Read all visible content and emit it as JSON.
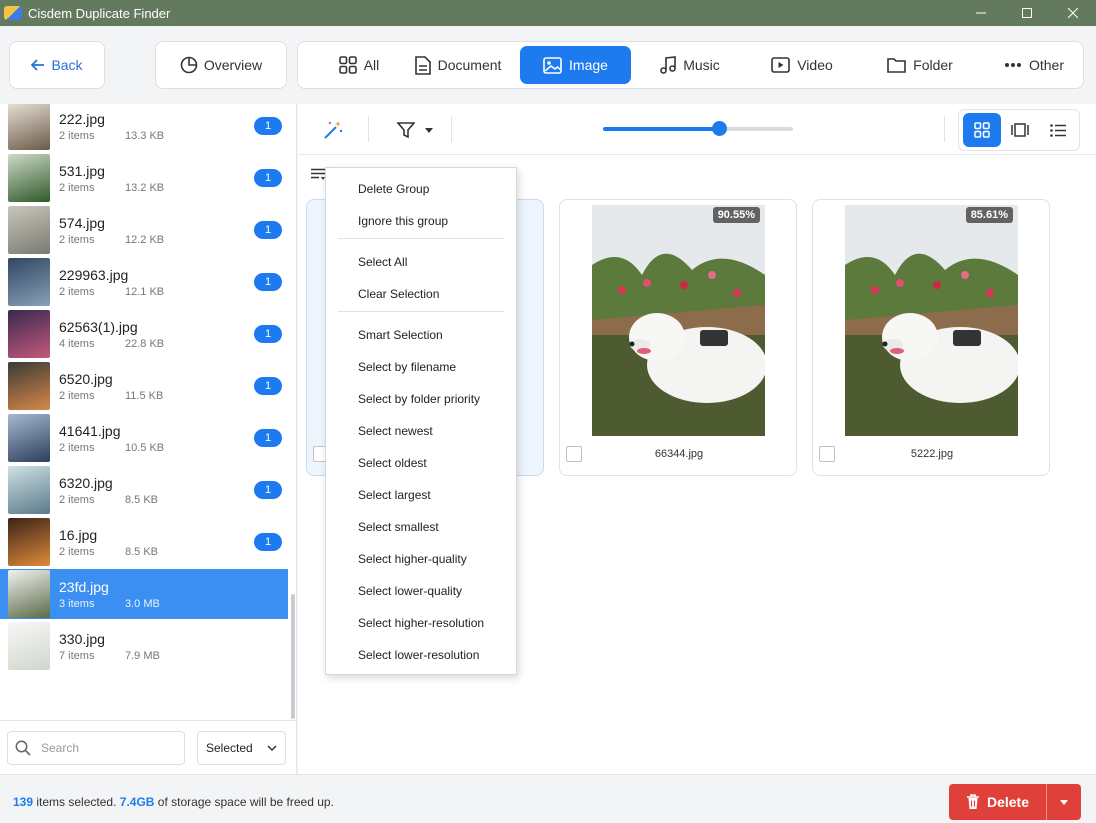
{
  "window": {
    "title": "Cisdem Duplicate Finder"
  },
  "nav": {
    "back_label": "Back",
    "overview_label": "Overview",
    "tabs": [
      {
        "label": "All",
        "icon": "grid-icon"
      },
      {
        "label": "Document",
        "icon": "document-icon"
      },
      {
        "label": "Image",
        "icon": "image-icon",
        "active": true
      },
      {
        "label": "Music",
        "icon": "music-note-icon"
      },
      {
        "label": "Video",
        "icon": "video-icon"
      },
      {
        "label": "Folder",
        "icon": "folder-icon"
      },
      {
        "label": "Other",
        "icon": "more-dots-icon"
      }
    ]
  },
  "sidebar": {
    "groups": [
      {
        "name": "222.jpg",
        "count": "2 items",
        "size": "13.3 KB",
        "badge": "1"
      },
      {
        "name": "531.jpg",
        "count": "2 items",
        "size": "13.2 KB",
        "badge": "1"
      },
      {
        "name": "574.jpg",
        "count": "2 items",
        "size": "12.2 KB",
        "badge": "1"
      },
      {
        "name": "229963.jpg",
        "count": "2 items",
        "size": "12.1 KB",
        "badge": "1"
      },
      {
        "name": "62563(1).jpg",
        "count": "4 items",
        "size": "22.8 KB",
        "badge": "1"
      },
      {
        "name": "6520.jpg",
        "count": "2 items",
        "size": "11.5 KB",
        "badge": "1"
      },
      {
        "name": "41641.jpg",
        "count": "2 items",
        "size": "10.5 KB",
        "badge": "1"
      },
      {
        "name": "6320.jpg",
        "count": "2 items",
        "size": "8.5 KB",
        "badge": "1"
      },
      {
        "name": "16.jpg",
        "count": "2 items",
        "size": "8.5 KB",
        "badge": "1"
      },
      {
        "name": "23fd.jpg",
        "count": "3 items",
        "size": "3.0 MB",
        "badge": "",
        "selected": true
      },
      {
        "name": "330.jpg",
        "count": "7 items",
        "size": "7.9 MB",
        "badge": ""
      }
    ],
    "search_placeholder": "Search",
    "filter_value": "Selected"
  },
  "main": {
    "zoom_fraction": 0.61,
    "cards": [
      {
        "filename": "",
        "similarity": ""
      },
      {
        "filename": "66344.jpg",
        "similarity": "90.55%"
      },
      {
        "filename": "5222.jpg",
        "similarity": "85.61%"
      }
    ]
  },
  "context_menu": {
    "items": [
      "Delete Group",
      "Ignore this group",
      "Select All",
      "Clear Selection",
      "Smart Selection",
      "Select by filename",
      "Select by folder priority",
      "Select newest",
      "Select oldest",
      "Select largest",
      "Select smallest",
      "Select higher-quality",
      "Select lower-quality",
      "Select higher-resolution",
      "Select lower-resolution"
    ]
  },
  "footer": {
    "selected_count": "139",
    "selected_text": "items selected.",
    "freed_size": "7.4GB",
    "freed_text": "of storage space will be freed up.",
    "delete_label": "Delete"
  },
  "colors": {
    "accent": "#1e7bef",
    "danger": "#e0403a",
    "titlebar": "#647a5e"
  }
}
